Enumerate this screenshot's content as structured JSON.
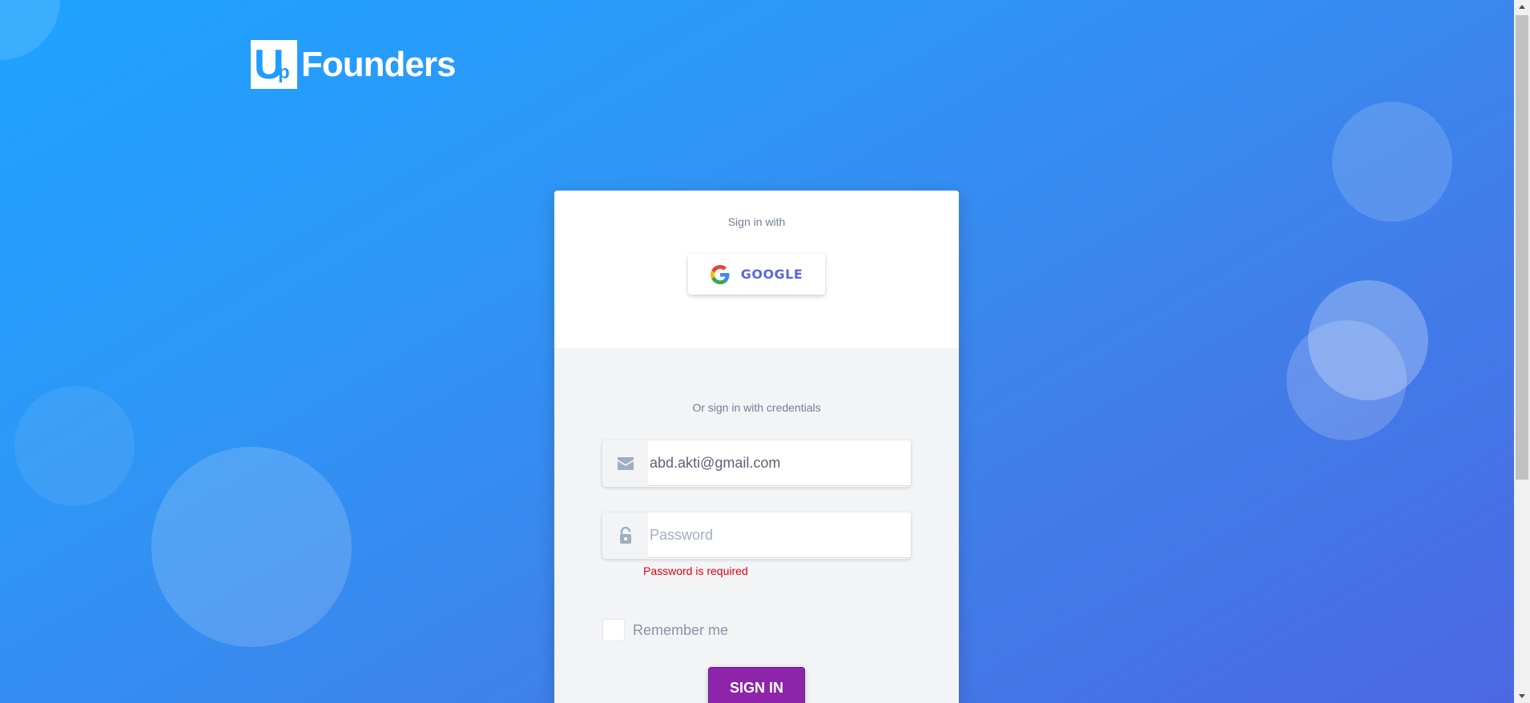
{
  "brand": {
    "logo_letter_big": "U",
    "logo_letter_small": "p",
    "logo_text": "Founders"
  },
  "social": {
    "heading": "Sign in with",
    "google_label": "GOOGLE",
    "google_icon": "google-g-icon"
  },
  "credentials": {
    "heading": "Or sign in with credentials",
    "email_icon": "envelope-icon",
    "email_value": "abd.akti@gmail.com",
    "password_icon": "unlock-icon",
    "password_placeholder": "Password",
    "password_error": "Password is required",
    "remember_label": "Remember me",
    "submit_label": "SIGN IN"
  },
  "colors": {
    "background_start": "#1ea3ff",
    "background_end": "#4b68e2",
    "submit_button": "#8e24aa",
    "google_text": "#5a67d8",
    "error": "#e3000f"
  }
}
